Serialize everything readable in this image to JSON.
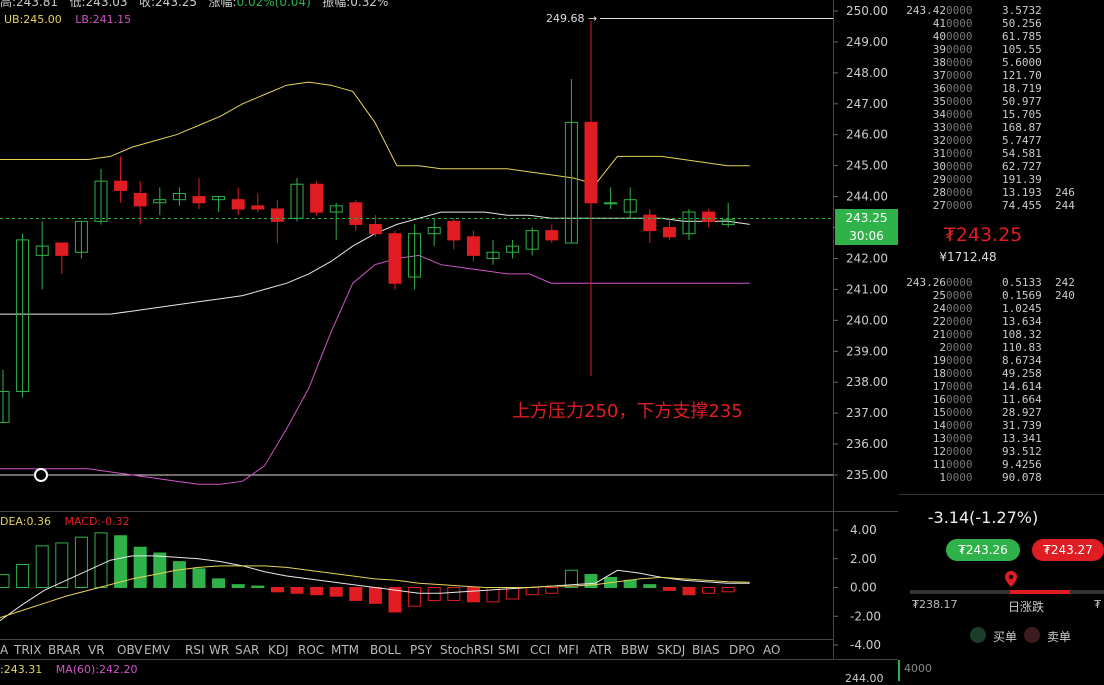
{
  "header": {
    "high_label": "高:",
    "high_value": "243.81",
    "low_label": "低:",
    "low_value": "243.03",
    "close_label": "收:",
    "close_value": "243.25",
    "change_label": "涨幅:",
    "change_value": "0.02%(0.04)",
    "amplitude_label": "振幅:",
    "amplitude_value": "0.32%"
  },
  "bollinger_legend": {
    "ub": "UB:245.00",
    "lb": "LB:241.15"
  },
  "peak_label": "249.68 →",
  "annotation": "上方压力250，下方支撑235",
  "current_price_tag": "243.25",
  "countdown_tag": "30:06",
  "price_axis": [
    "250.00",
    "249.00",
    "248.00",
    "247.00",
    "246.00",
    "245.00",
    "244.00",
    "243.00",
    "242.00",
    "241.00",
    "240.00",
    "239.00",
    "238.00",
    "237.00",
    "236.00",
    "235.00"
  ],
  "macd_legend": {
    "dea": "DEA:0.36",
    "macd": "MACD:-0.32"
  },
  "macd_axis": [
    "4.00",
    "2.00",
    "0.00",
    "-2.00",
    "-4.00"
  ],
  "indicator_tabs": [
    "A",
    "TRIX",
    "BRAR",
    "VR",
    "OBV",
    "EMV",
    "RSI",
    "WR",
    "SAR",
    "KDJ",
    "ROC",
    "MTM",
    "BOLL",
    "PSY",
    "StochRSI",
    "SMI",
    "CCI",
    "MFI",
    "ATR",
    "BBW",
    "SKDJ",
    "BIAS",
    "DPO",
    "AO"
  ],
  "ma_legend": {
    "ma_a": ":243.31",
    "ma60": "MA(60):242.20"
  },
  "bottom_axis_value": "244.00",
  "orderbook": {
    "asks": [
      {
        "price": "243.42",
        "zeros": "0000",
        "qty": "3.5732",
        "extra": ""
      },
      {
        "price": "41",
        "zeros": "0000",
        "qty": "50.256",
        "extra": ""
      },
      {
        "price": "40",
        "zeros": "0000",
        "qty": "61.785",
        "extra": ""
      },
      {
        "price": "39",
        "zeros": "0000",
        "qty": "105.55",
        "extra": ""
      },
      {
        "price": "38",
        "zeros": "0000",
        "qty": "5.6000",
        "extra": ""
      },
      {
        "price": "37",
        "zeros": "0000",
        "qty": "121.70",
        "extra": ""
      },
      {
        "price": "36",
        "zeros": "0000",
        "qty": "18.719",
        "extra": ""
      },
      {
        "price": "35",
        "zeros": "0000",
        "qty": "50.977",
        "extra": ""
      },
      {
        "price": "34",
        "zeros": "0000",
        "qty": "15.705",
        "extra": ""
      },
      {
        "price": "33",
        "zeros": "0000",
        "qty": "168.87",
        "extra": ""
      },
      {
        "price": "32",
        "zeros": "0000",
        "qty": "5.7477",
        "extra": ""
      },
      {
        "price": "31",
        "zeros": "0000",
        "qty": "54.581",
        "extra": ""
      },
      {
        "price": "30",
        "zeros": "0000",
        "qty": "62.727",
        "extra": ""
      },
      {
        "price": "29",
        "zeros": "0000",
        "qty": "191.39",
        "extra": ""
      },
      {
        "price": "28",
        "zeros": "0000",
        "qty": "13.193",
        "extra": "246"
      },
      {
        "price": "27",
        "zeros": "0000",
        "qty": "74.455",
        "extra": "244"
      }
    ],
    "last_price": "₮243.25",
    "last_price_cny": "¥1712.48",
    "bids": [
      {
        "price": "243.26",
        "zeros": "0000",
        "qty": "0.5133",
        "extra": "242"
      },
      {
        "price": "25",
        "zeros": "0000",
        "qty": "0.1569",
        "extra": "240"
      },
      {
        "price": "24",
        "zeros": "0000",
        "qty": "1.0245",
        "extra": ""
      },
      {
        "price": "22",
        "zeros": "0000",
        "qty": "13.634",
        "extra": ""
      },
      {
        "price": "21",
        "zeros": "0000",
        "qty": "108.32",
        "extra": ""
      },
      {
        "price": "2",
        "zeros": "0000",
        "qty": "110.83",
        "extra": ""
      },
      {
        "price": "19",
        "zeros": "0000",
        "qty": "8.6734",
        "extra": ""
      },
      {
        "price": "18",
        "zeros": "0000",
        "qty": "49.258",
        "extra": ""
      },
      {
        "price": "17",
        "zeros": "0000",
        "qty": "14.614",
        "extra": ""
      },
      {
        "price": "16",
        "zeros": "0000",
        "qty": "11.664",
        "extra": ""
      },
      {
        "price": "15",
        "zeros": "0000",
        "qty": "28.927",
        "extra": ""
      },
      {
        "price": "14",
        "zeros": "0000",
        "qty": "31.739",
        "extra": ""
      },
      {
        "price": "13",
        "zeros": "0000",
        "qty": "13.341",
        "extra": ""
      },
      {
        "price": "12",
        "zeros": "0000",
        "qty": "93.512",
        "extra": ""
      },
      {
        "price": "11",
        "zeros": "0000",
        "qty": "9.4256",
        "extra": ""
      },
      {
        "price": "1",
        "zeros": "0000",
        "qty": "90.078",
        "extra": ""
      }
    ]
  },
  "summary": {
    "change": "-3.14(-1.27%)",
    "bid_button": "₮243.26",
    "ask_button": "₮243.27",
    "range_low": "₮238.17",
    "range_label": "日涨跌",
    "range_high": "₮",
    "buy_label": "买单",
    "sell_label": "卖单",
    "corner_value": "4000"
  },
  "colors": {
    "up": "#2fb24a",
    "down": "#e01d22",
    "ub": "#e6d35a",
    "mid": "#e8e8e8",
    "lb": "#d154c8",
    "dif": "#e8e8e8",
    "dea": "#e6d35a"
  },
  "chart_data": [
    {
      "type": "candlestick",
      "title": "",
      "ylim": [
        234.5,
        250.3
      ],
      "candles": [
        {
          "o": 236.7,
          "h": 238.4,
          "l": 236.7,
          "c": 237.7
        },
        {
          "o": 237.7,
          "h": 242.8,
          "l": 237.5,
          "c": 242.6
        },
        {
          "o": 242.1,
          "h": 243.2,
          "l": 241.0,
          "c": 242.4
        },
        {
          "o": 242.5,
          "h": 242.5,
          "l": 241.5,
          "c": 242.1
        },
        {
          "o": 242.2,
          "h": 243.2,
          "l": 242.0,
          "c": 243.2
        },
        {
          "o": 243.2,
          "h": 244.9,
          "l": 243.1,
          "c": 244.5
        },
        {
          "o": 244.5,
          "h": 245.3,
          "l": 243.8,
          "c": 244.2
        },
        {
          "o": 244.1,
          "h": 244.5,
          "l": 243.1,
          "c": 243.7
        },
        {
          "o": 243.8,
          "h": 244.3,
          "l": 243.4,
          "c": 243.9
        },
        {
          "o": 243.9,
          "h": 244.3,
          "l": 243.7,
          "c": 244.1
        },
        {
          "o": 244.0,
          "h": 244.6,
          "l": 243.6,
          "c": 243.8
        },
        {
          "o": 243.9,
          "h": 244.0,
          "l": 243.5,
          "c": 244.0
        },
        {
          "o": 243.9,
          "h": 244.3,
          "l": 243.4,
          "c": 243.6
        },
        {
          "o": 243.7,
          "h": 244.1,
          "l": 243.5,
          "c": 243.6
        },
        {
          "o": 243.6,
          "h": 243.9,
          "l": 242.5,
          "c": 243.2
        },
        {
          "o": 243.3,
          "h": 244.6,
          "l": 243.2,
          "c": 244.4
        },
        {
          "o": 244.4,
          "h": 244.5,
          "l": 243.4,
          "c": 243.5
        },
        {
          "o": 243.5,
          "h": 243.8,
          "l": 242.6,
          "c": 243.7
        },
        {
          "o": 243.8,
          "h": 243.9,
          "l": 242.9,
          "c": 243.1
        },
        {
          "o": 243.1,
          "h": 243.4,
          "l": 242.7,
          "c": 242.8
        },
        {
          "o": 242.8,
          "h": 242.9,
          "l": 241.0,
          "c": 241.2
        },
        {
          "o": 241.4,
          "h": 243.1,
          "l": 241.0,
          "c": 242.8
        },
        {
          "o": 242.8,
          "h": 243.3,
          "l": 242.4,
          "c": 243.0
        },
        {
          "o": 243.2,
          "h": 243.3,
          "l": 242.3,
          "c": 242.6
        },
        {
          "o": 242.7,
          "h": 242.9,
          "l": 241.9,
          "c": 242.1
        },
        {
          "o": 242.0,
          "h": 242.6,
          "l": 241.8,
          "c": 242.2
        },
        {
          "o": 242.2,
          "h": 242.6,
          "l": 242.0,
          "c": 242.4
        },
        {
          "o": 242.3,
          "h": 243.0,
          "l": 242.1,
          "c": 242.9
        },
        {
          "o": 242.9,
          "h": 243.1,
          "l": 242.5,
          "c": 242.6
        },
        {
          "o": 242.5,
          "h": 247.8,
          "l": 242.5,
          "c": 246.4
        },
        {
          "o": 246.4,
          "h": 249.68,
          "l": 238.2,
          "c": 243.8
        },
        {
          "o": 243.8,
          "h": 244.3,
          "l": 243.6,
          "c": 243.8
        },
        {
          "o": 243.5,
          "h": 244.3,
          "l": 243.3,
          "c": 243.9
        },
        {
          "o": 243.4,
          "h": 243.6,
          "l": 242.5,
          "c": 242.9
        },
        {
          "o": 243.0,
          "h": 243.3,
          "l": 242.6,
          "c": 242.7
        },
        {
          "o": 242.8,
          "h": 243.6,
          "l": 242.6,
          "c": 243.5
        },
        {
          "o": 243.5,
          "h": 243.6,
          "l": 243.0,
          "c": 243.2
        },
        {
          "o": 243.1,
          "h": 243.8,
          "l": 243.0,
          "c": 243.25
        }
      ],
      "boll_ub": [
        245.2,
        245.2,
        245.2,
        245.2,
        245.2,
        245.3,
        245.6,
        245.8,
        246.0,
        246.3,
        246.6,
        247.0,
        247.3,
        247.6,
        247.7,
        247.6,
        247.4,
        246.4,
        245.0,
        245.0,
        244.9,
        244.9,
        244.9,
        244.9,
        244.8,
        244.7,
        244.6,
        244.4,
        245.3,
        245.3,
        245.3,
        245.2,
        245.1,
        245.0,
        245.0
      ],
      "boll_mid": [
        240.2,
        240.2,
        240.2,
        240.2,
        240.2,
        240.2,
        240.3,
        240.4,
        240.5,
        240.6,
        240.7,
        240.8,
        241.0,
        241.2,
        241.5,
        241.9,
        242.4,
        242.8,
        243.1,
        243.3,
        243.5,
        243.5,
        243.5,
        243.4,
        243.4,
        243.3,
        243.3,
        243.3,
        243.3,
        243.3,
        243.3,
        243.2,
        243.2,
        243.2,
        243.1
      ],
      "boll_lb": [
        235.2,
        235.2,
        235.2,
        235.2,
        235.2,
        235.1,
        235.0,
        234.9,
        234.8,
        234.7,
        234.7,
        234.8,
        235.3,
        236.5,
        237.8,
        239.6,
        241.2,
        241.8,
        242.0,
        242.1,
        241.8,
        241.7,
        241.6,
        241.5,
        241.5,
        241.2,
        241.2,
        241.2,
        241.2,
        241.2,
        241.2,
        241.2,
        241.2,
        241.2,
        241.2
      ],
      "level_line": 235.0
    },
    {
      "type": "bar",
      "title": "MACD",
      "ylim": [
        -4.0,
        4.0
      ],
      "histogram": [
        0.9,
        1.6,
        2.9,
        3.1,
        3.5,
        3.8,
        3.6,
        2.8,
        2.4,
        1.8,
        1.3,
        0.6,
        0.2,
        0.1,
        -0.3,
        -0.4,
        -0.5,
        -0.6,
        -0.9,
        -1.1,
        -1.7,
        -1.3,
        -0.9,
        -0.9,
        -1.0,
        -1.0,
        -0.8,
        -0.5,
        -0.4,
        1.2,
        0.9,
        0.7,
        0.5,
        0.2,
        -0.2,
        -0.5,
        -0.4,
        -0.3
      ],
      "dif": [
        -2.3,
        -1.2,
        -0.2,
        0.5,
        1.2,
        1.9,
        2.2,
        2.2,
        2.1,
        2.0,
        1.8,
        1.5,
        1.1,
        0.8,
        0.6,
        0.4,
        0.2,
        0.0,
        -0.2,
        -0.4,
        -0.4,
        -0.3,
        -0.2,
        -0.1,
        0.0,
        0.1,
        0.2,
        0.3,
        1.2,
        1.0,
        0.7,
        0.5,
        0.4,
        0.3,
        0.3
      ],
      "dea": [
        -2.1,
        -1.6,
        -1.1,
        -0.6,
        -0.2,
        0.2,
        0.6,
        0.9,
        1.2,
        1.4,
        1.5,
        1.5,
        1.5,
        1.4,
        1.2,
        1.0,
        0.8,
        0.6,
        0.5,
        0.3,
        0.2,
        0.1,
        0.0,
        0.0,
        0.0,
        0.1,
        0.1,
        0.2,
        0.4,
        0.6,
        0.7,
        0.6,
        0.5,
        0.4,
        0.36
      ]
    }
  ]
}
